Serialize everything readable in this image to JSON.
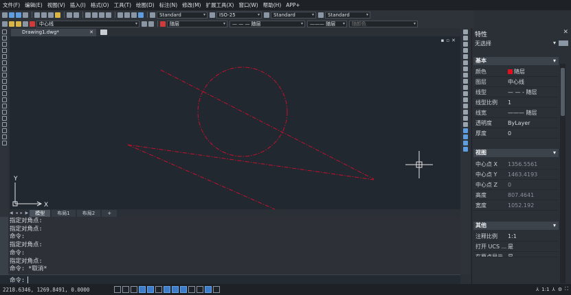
{
  "menu": [
    "文件(F)",
    "编辑(E)",
    "视图(V)",
    "插入(I)",
    "格式(O)",
    "工具(T)",
    "绘图(D)",
    "标注(N)",
    "修改(M)",
    "扩展工具(X)",
    "窗口(W)",
    "帮助(H)",
    "APP+"
  ],
  "toolbar": {
    "text_style": "Standard",
    "dim_style": "ISO-25",
    "table_style": "Standard",
    "multileader_style": "Standard",
    "layer": "中心线",
    "color": "随层",
    "linetype": "— — — 随层",
    "lineweight": "——— 随层",
    "plot_style": "随颜色"
  },
  "document": {
    "tab": "Drawing1.dwg*"
  },
  "layout_tabs": [
    "模型",
    "布局1",
    "布局2",
    "+"
  ],
  "ucs": {
    "x": "X",
    "y": "Y"
  },
  "command": {
    "history": [
      "指定对角点:",
      "指定对角点:",
      "命令:",
      "指定对角点:",
      "命令:",
      "指定对角点:",
      "命令: *取消*"
    ],
    "prompt": "命令:"
  },
  "status": {
    "coords": "2218.6346, 1269.8491, 0.0000",
    "scale": "1:1"
  },
  "properties": {
    "title": "特性",
    "selection": "无选择",
    "sections": {
      "basic": {
        "label": "基本",
        "rows": [
          {
            "k": "颜色",
            "v": "随层"
          },
          {
            "k": "图层",
            "v": "中心线"
          },
          {
            "k": "线型",
            "v": "— — - 随层"
          },
          {
            "k": "线型比例",
            "v": "1"
          },
          {
            "k": "线宽",
            "v": "——— 随层"
          },
          {
            "k": "透明度",
            "v": "ByLayer"
          },
          {
            "k": "厚度",
            "v": "0"
          }
        ]
      },
      "view": {
        "label": "视图",
        "rows": [
          {
            "k": "中心点 X",
            "v": "1356.5561"
          },
          {
            "k": "中心点 Y",
            "v": "1463.4193"
          },
          {
            "k": "中心点 Z",
            "v": "0"
          },
          {
            "k": "高度",
            "v": "807.4641"
          },
          {
            "k": "宽度",
            "v": "1052.192"
          }
        ]
      },
      "misc": {
        "label": "其他",
        "rows": [
          {
            "k": "注释比例",
            "v": "1:1"
          },
          {
            "k": "打开 UCS ...",
            "v": "是"
          },
          {
            "k": "在原点显示...",
            "v": "是"
          }
        ]
      }
    }
  },
  "colors": {
    "geometry": "#c8102e",
    "canvas": "#212830"
  }
}
